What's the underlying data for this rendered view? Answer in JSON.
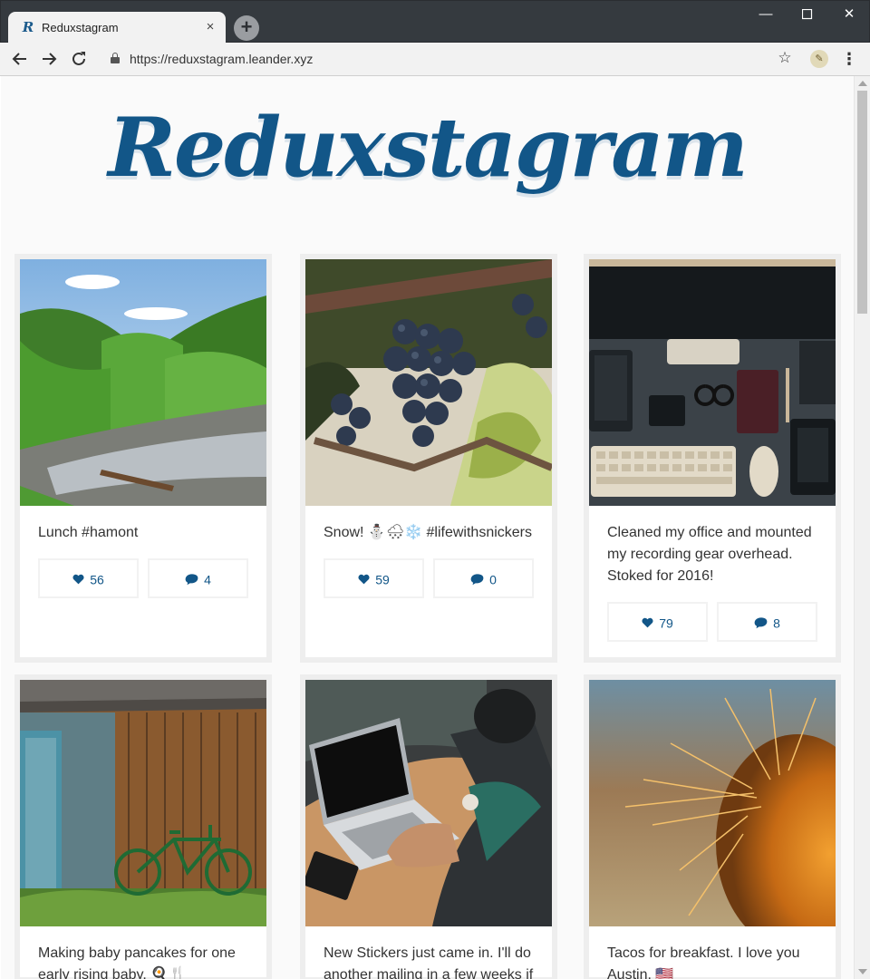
{
  "browser": {
    "tab_title": "Reduxstagram",
    "tab_favicon": "R",
    "tab_close": "×",
    "new_tab": "+",
    "url": "https://reduxstagram.leander.xyz",
    "window_controls": {
      "minimize": "—",
      "maximize": "☐",
      "close": "✕"
    }
  },
  "page": {
    "logo_text": "Reduxstagram",
    "accent_color": "#125688",
    "posts": [
      {
        "caption": "Lunch #hamont",
        "likes": "56",
        "comments": "4",
        "photo": "forest-river"
      },
      {
        "caption": "Snow! ⛄🌨❄️ #lifewithsnickers",
        "likes": "59",
        "comments": "0",
        "photo": "grapes"
      },
      {
        "caption": "Cleaned my office and mounted my recording gear overhead. Stoked for 2016!",
        "likes": "79",
        "comments": "8",
        "photo": "desk-flatlay"
      },
      {
        "caption": "Making baby pancakes for one early rising baby. 🍳🍴",
        "likes": "",
        "comments": "",
        "photo": "barn-bicycle"
      },
      {
        "caption": "New Stickers just came in. I'll do another mailing in a few weeks if",
        "likes": "",
        "comments": "",
        "photo": "laptop"
      },
      {
        "caption": "Tacos for breakfast. I love you Austin. 🇺🇸",
        "likes": "",
        "comments": "",
        "photo": "cactus"
      }
    ]
  }
}
